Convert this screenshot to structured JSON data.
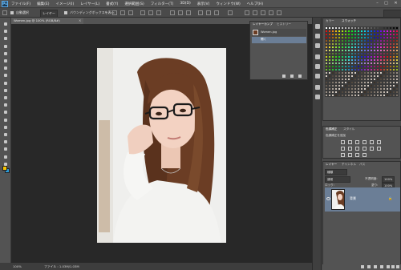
{
  "menu": {
    "logo": "Ps",
    "items": [
      "ファイル(F)",
      "編集(E)",
      "イメージ(I)",
      "レイヤー(L)",
      "書式(Y)",
      "選択範囲(S)",
      "フィルター(T)",
      "3D(D)",
      "表示(V)",
      "ウィンドウ(W)",
      "ヘルプ(H)"
    ],
    "window_controls": [
      "–",
      "□",
      "✕"
    ]
  },
  "options_bar": {
    "auto_select": "自動選択",
    "select_target": "レイヤー",
    "transform_controls": "バウンディングボックスを表示"
  },
  "document_tab": {
    "title": "Women.jpg @ 100% (RGB/8#)",
    "close": "×"
  },
  "status_bar": {
    "zoom": "100%",
    "info": "ファイル : 1.03M/1.03M"
  },
  "comps_panel": {
    "tabs": [
      "レイヤーカンプ",
      "ヒストリー"
    ],
    "items": [
      {
        "label": "Women.jpg"
      },
      {
        "label": "開く"
      }
    ]
  },
  "swatches_panel": {
    "tabs": [
      "カラー",
      "スウォッチ"
    ]
  },
  "adjustments_panel": {
    "tabs": [
      "色調補正",
      "スタイル"
    ],
    "title": "色調補正を追加"
  },
  "layers_panel": {
    "tabs": [
      "レイヤー",
      "チャンネル",
      "パス"
    ],
    "kind_filter": "種類",
    "blend_mode": "通常",
    "opacity_label": "不透明度:",
    "opacity_value": "100%",
    "lock_label": "ロック:",
    "fill_label": "塗り:",
    "fill_value": "100%",
    "layers": [
      {
        "name": "背景",
        "locked": true
      }
    ]
  },
  "colors": {
    "foreground": "#f5c400",
    "background": "#2b9bd8",
    "selected_layer": "#6b7e96"
  }
}
